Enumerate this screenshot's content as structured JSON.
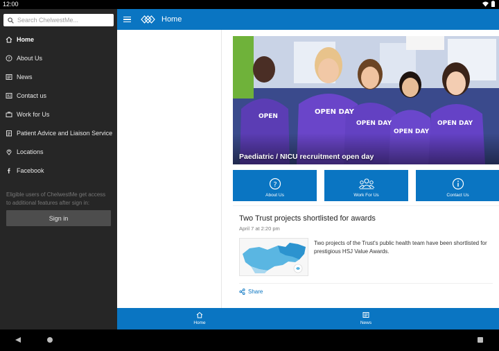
{
  "status_bar": {
    "time": "12:00"
  },
  "drawer": {
    "search_placeholder": "Search ChelwestMe...",
    "items": [
      {
        "label": "Home",
        "icon": "home-icon",
        "active": true
      },
      {
        "label": "About Us",
        "icon": "help-circle-icon"
      },
      {
        "label": "News",
        "icon": "newspaper-icon"
      },
      {
        "label": "Contact us",
        "icon": "contact-card-icon"
      },
      {
        "label": "Work for Us",
        "icon": "briefcase-icon"
      },
      {
        "label": "Patient Advice and Liaison Service",
        "icon": "clipboard-icon"
      },
      {
        "label": "Locations",
        "icon": "map-pin-icon"
      },
      {
        "label": "Facebook",
        "icon": "facebook-icon"
      }
    ],
    "signin_note": "Eligible users of ChelwestMe get access to additional features after sign in:",
    "signin_label": "Sign in"
  },
  "app_bar": {
    "title": "Home"
  },
  "hero": {
    "caption": "Paediatric / NICU recruitment open day"
  },
  "tiles": [
    {
      "label": "About Us",
      "icon": "help-circle-icon"
    },
    {
      "label": "Work For Us",
      "icon": "people-group-icon"
    },
    {
      "label": "Contact Us",
      "icon": "info-circle-icon"
    }
  ],
  "news_card": {
    "title": "Two Trust projects shortlisted for awards",
    "date": "April 7 at 2:20 pm",
    "summary": "Two projects of the Trust's public health team have been shortlisted for prestigious HSJ Value Awards.",
    "share_label": "Share"
  },
  "bottom_nav": [
    {
      "label": "Home",
      "icon": "home-icon"
    },
    {
      "label": "News",
      "icon": "newspaper-icon"
    }
  ],
  "colors": {
    "primary": "#0a75c2",
    "drawer_bg": "#262626",
    "signin_btn": "#4d4d4d"
  }
}
